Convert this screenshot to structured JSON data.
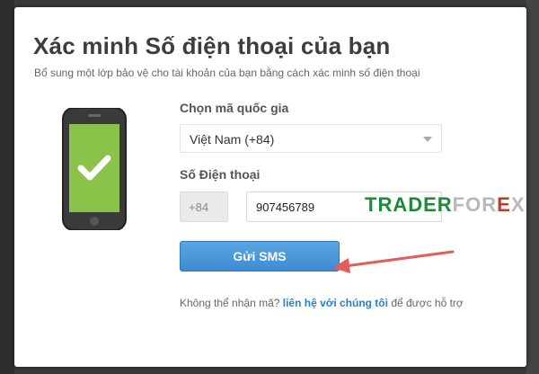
{
  "dialog": {
    "title": "Xác minh Số điện thoại của bạn",
    "subtitle": "Bổ sung một lớp bảo vệ cho tài khoản của bạn bằng cách xác minh số điện thoại"
  },
  "form": {
    "country_label": "Chọn mã quốc gia",
    "country_selected": "Việt Nam (+84)",
    "phone_label": "Số Điện thoại",
    "phone_prefix": "+84",
    "phone_value": "907456789",
    "send_button": "Gửi SMS"
  },
  "help": {
    "prefix_text": "Không thể nhận mã? ",
    "link_text": "liên hệ với chúng tôi",
    "suffix_text": " để được hỗ trợ"
  },
  "watermark": {
    "part1": "TRADER",
    "part2": "FOR",
    "part3": "E",
    "part4": "X"
  },
  "colors": {
    "primary_button": "#3d8cd3",
    "check_green": "#8bc34a",
    "link": "#2a7fc9",
    "arrow": "#e35b5b"
  },
  "icons": {
    "phone": "smartphone-check-icon",
    "dropdown": "chevron-down-icon",
    "pointer": "red-arrow-icon"
  }
}
